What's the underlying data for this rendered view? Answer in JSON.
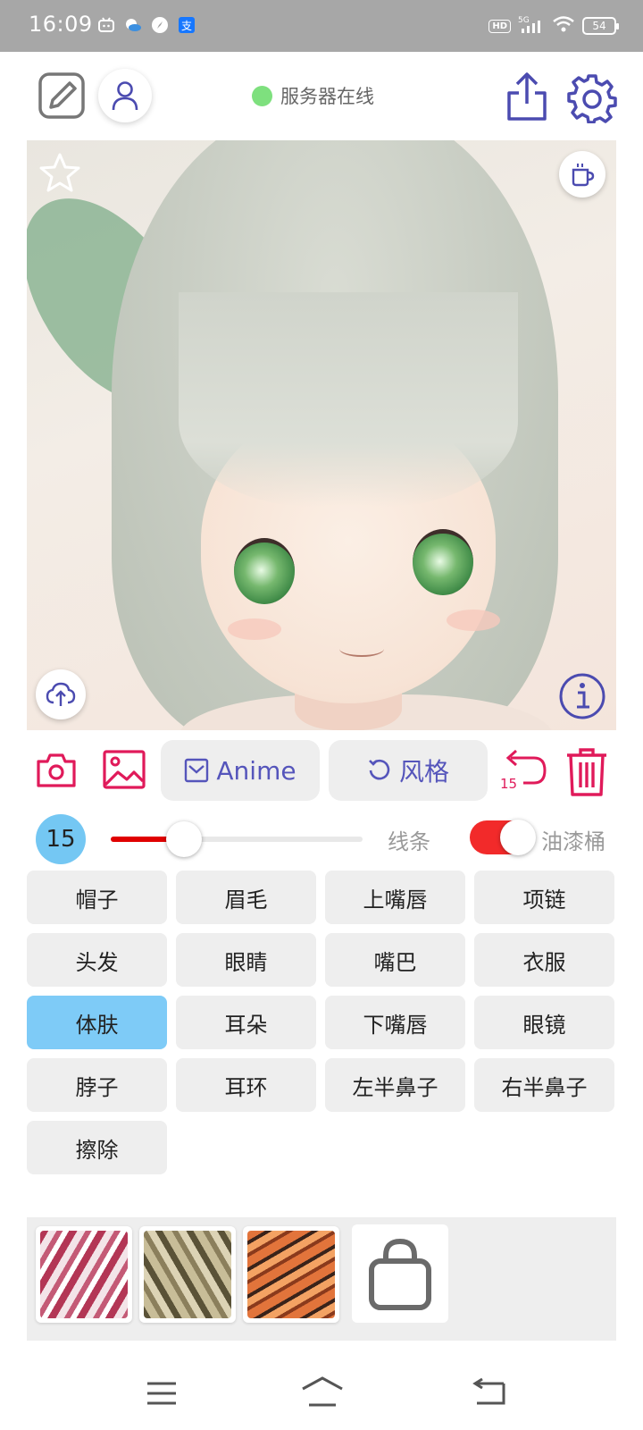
{
  "status_bar": {
    "time": "16:09",
    "hd": "HD",
    "network": "5G",
    "battery": "54"
  },
  "toolbar": {
    "server_status": "服务器在线",
    "server_status_color": "#7ee07e",
    "icons": [
      "edit-icon",
      "user-icon",
      "share-icon",
      "settings-icon"
    ]
  },
  "canvas": {
    "icons": [
      "star-icon",
      "coffee-cup-icon",
      "cloud-upload-icon",
      "info-icon"
    ]
  },
  "actions": {
    "anime_label": "Anime",
    "style_label": "风格",
    "undo_count": "15",
    "accent_color": "#e01a5a",
    "pill_text_color": "#5555bb"
  },
  "brush": {
    "size": "15",
    "slider_fraction": 0.29,
    "line_label": "线条",
    "bucket_label": "油漆桶",
    "bucket_enabled": true
  },
  "segments": {
    "active": "体肤",
    "items": [
      "帽子",
      "眉毛",
      "上嘴唇",
      "项链",
      "头发",
      "眼睛",
      "嘴巴",
      "衣服",
      "体肤",
      "耳朵",
      "下嘴唇",
      "眼镜",
      "脖子",
      "耳环",
      "左半鼻子",
      "右半鼻子",
      "擦除"
    ]
  },
  "palette": {
    "swatches": [
      "pink-stripe-texture",
      "olive-stripe-texture",
      "orange-tiger-texture"
    ],
    "store_icon": "shopping-bag-icon"
  }
}
